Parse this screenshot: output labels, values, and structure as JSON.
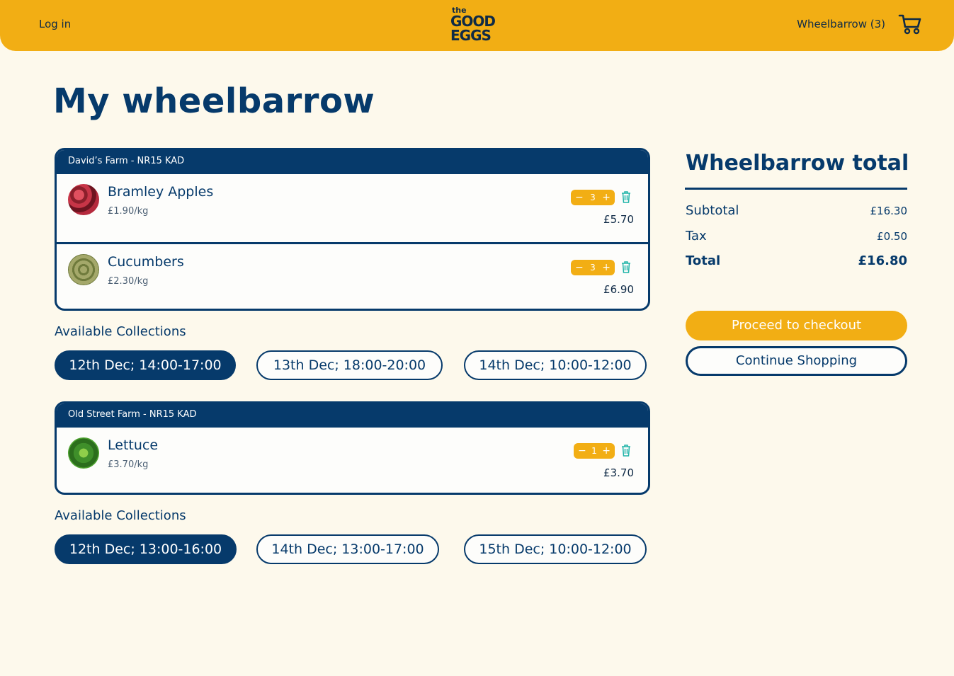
{
  "header": {
    "login_label": "Log in",
    "logo": {
      "the": "the",
      "line1": "GOOD",
      "line2": "EGGS"
    },
    "wheelbarrow_label": "Wheelbarrow (3)",
    "cart_icon": "wheelbarrow-cart-icon"
  },
  "page_title": "My wheelbarrow",
  "farms": [
    {
      "name": "David’s Farm - NR15 KAD",
      "items": [
        {
          "name": "Bramley Apples",
          "price": "£1.90/kg",
          "qty": "3",
          "total": "£5.70",
          "thumb": "apples"
        },
        {
          "name": "Cucumbers",
          "price": "£2.30/kg",
          "qty": "3",
          "total": "£6.90",
          "thumb": "cucumber"
        }
      ],
      "collections_label": "Available Collections",
      "slots": [
        "12th Dec; 14:00-17:00",
        "13th Dec; 18:00-20:00",
        "14th Dec; 10:00-12:00"
      ],
      "selected_slot": "12th Dec; 14:00-17:00"
    },
    {
      "name": "Old Street Farm - NR15 KAD",
      "items": [
        {
          "name": "Lettuce",
          "price": "£3.70/kg",
          "qty": "1",
          "total": "£3.70",
          "thumb": "lettuce"
        }
      ],
      "collections_label": "Available Collections",
      "slots": [
        "12th Dec; 13:00-16:00",
        "14th Dec; 13:00-17:00",
        "15th Dec; 10:00-12:00"
      ],
      "selected_slot": "12th Dec; 13:00-16:00"
    }
  ],
  "stepper": {
    "minus": "−",
    "plus": "+"
  },
  "summary": {
    "title": "Wheelbarrow total",
    "subtotal_label": "Subtotal",
    "subtotal": "£16.30",
    "tax_label": "Tax",
    "tax": "£0.50",
    "total_label": "Total",
    "total": "£16.80"
  },
  "buttons": {
    "checkout": "Proceed to checkout",
    "continue": "Continue Shopping"
  },
  "colors": {
    "brand_yellow": "#f2ae14",
    "navy": "#063a6b",
    "background": "#fdf9ec",
    "trash": "#1fb3a8"
  }
}
